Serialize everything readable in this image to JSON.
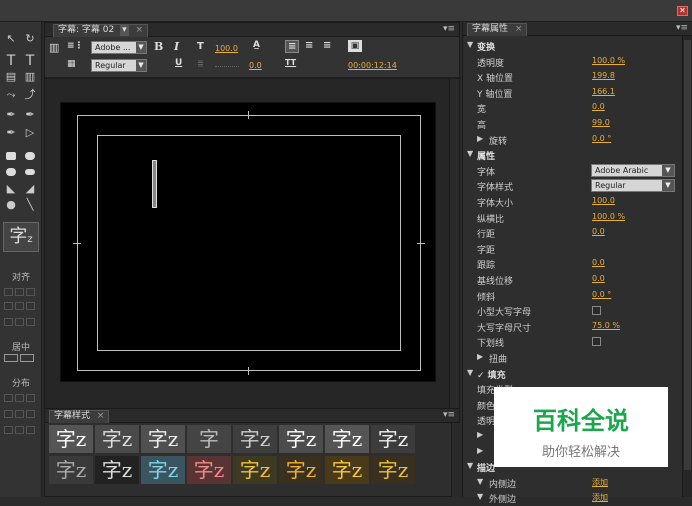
{
  "window": {
    "close_glyph": "✕"
  },
  "tools": {
    "big_glyph": "字",
    "big_glyph_sub": "z",
    "align_label": "对齐",
    "center_label": "居中",
    "distribute_label": "分布"
  },
  "editor": {
    "tab_label": "字幕: 字幕 02",
    "tab_dropdown": "▾",
    "tab_close": "×",
    "panel_menu": "▾≡",
    "font_family": "Adobe ...",
    "font_style": "Regular",
    "bold": "B",
    "italic": "I",
    "underline": "U",
    "font_size": "100.0",
    "kerning": "0.0",
    "timecode": "00:00:12:14",
    "tab_stop": "TT"
  },
  "styles": {
    "tab_label": "字幕样式",
    "tab_close": "×",
    "panel_menu": "▾≡",
    "swatches_row1": [
      "字z",
      "字z",
      "字z",
      "字",
      "字z",
      "字z",
      "字z",
      "字z"
    ],
    "swatches_row2": [
      "字z",
      "字z",
      "字z",
      "字z",
      "字z",
      "字z",
      "字z",
      "字z"
    ]
  },
  "props": {
    "tab_label": "字幕属性",
    "tab_close": "×",
    "panel_menu": "▾≡",
    "rows": [
      {
        "type": "header",
        "tri": "▼",
        "label": "变换"
      },
      {
        "type": "val",
        "label": "透明度",
        "value": "100.0 %"
      },
      {
        "type": "val",
        "label": "X 轴位置",
        "value": "199.8"
      },
      {
        "type": "val",
        "label": "Y 轴位置",
        "value": "166.1"
      },
      {
        "type": "val",
        "label": "宽",
        "value": "0.0"
      },
      {
        "type": "val",
        "label": "高",
        "value": "99.0"
      },
      {
        "type": "sub",
        "tri": "▶",
        "label": "旋转",
        "value": "0.0 °"
      },
      {
        "type": "header",
        "tri": "▼",
        "label": "属性"
      },
      {
        "type": "select",
        "label": "字体",
        "value": "Adobe Arabic"
      },
      {
        "type": "select",
        "label": "字体样式",
        "value": "Regular"
      },
      {
        "type": "val",
        "label": "字体大小",
        "value": "100.0"
      },
      {
        "type": "val",
        "label": "纵横比",
        "value": "100.0 %"
      },
      {
        "type": "val",
        "label": "行距",
        "value": "0.0"
      },
      {
        "type": "val",
        "label": "字距",
        "value": ""
      },
      {
        "type": "val",
        "label": "跟踪",
        "value": "0.0"
      },
      {
        "type": "val",
        "label": "基线位移",
        "value": "0.0"
      },
      {
        "type": "val",
        "label": "倾斜",
        "value": "0.0 °"
      },
      {
        "type": "check",
        "label": "小型大写字母"
      },
      {
        "type": "val",
        "label": "大写字母尺寸",
        "value": "75.0 %"
      },
      {
        "type": "check",
        "label": "下划线"
      },
      {
        "type": "sub",
        "tri": "▶",
        "label": "扭曲",
        "value": ""
      },
      {
        "type": "header",
        "tri": "▼",
        "label": "✓ 填充"
      },
      {
        "type": "val",
        "label": "填充类型",
        "value": ""
      },
      {
        "type": "val",
        "label": "颜色",
        "value": ""
      },
      {
        "type": "val",
        "label": "透明",
        "value": ""
      },
      {
        "type": "sub",
        "tri": "▶",
        "label": "",
        "value": ""
      },
      {
        "type": "sub",
        "tri": "▶",
        "label": "",
        "value": ""
      },
      {
        "type": "header",
        "tri": "▼",
        "label": "描边"
      },
      {
        "type": "sub",
        "tri": "▼",
        "label": "内侧边",
        "value": "添加"
      },
      {
        "type": "sub",
        "tri": "▼",
        "label": "外侧边",
        "value": "添加"
      }
    ]
  },
  "watermark": {
    "title": "百科全说",
    "subtitle": "助你轻松解决"
  }
}
